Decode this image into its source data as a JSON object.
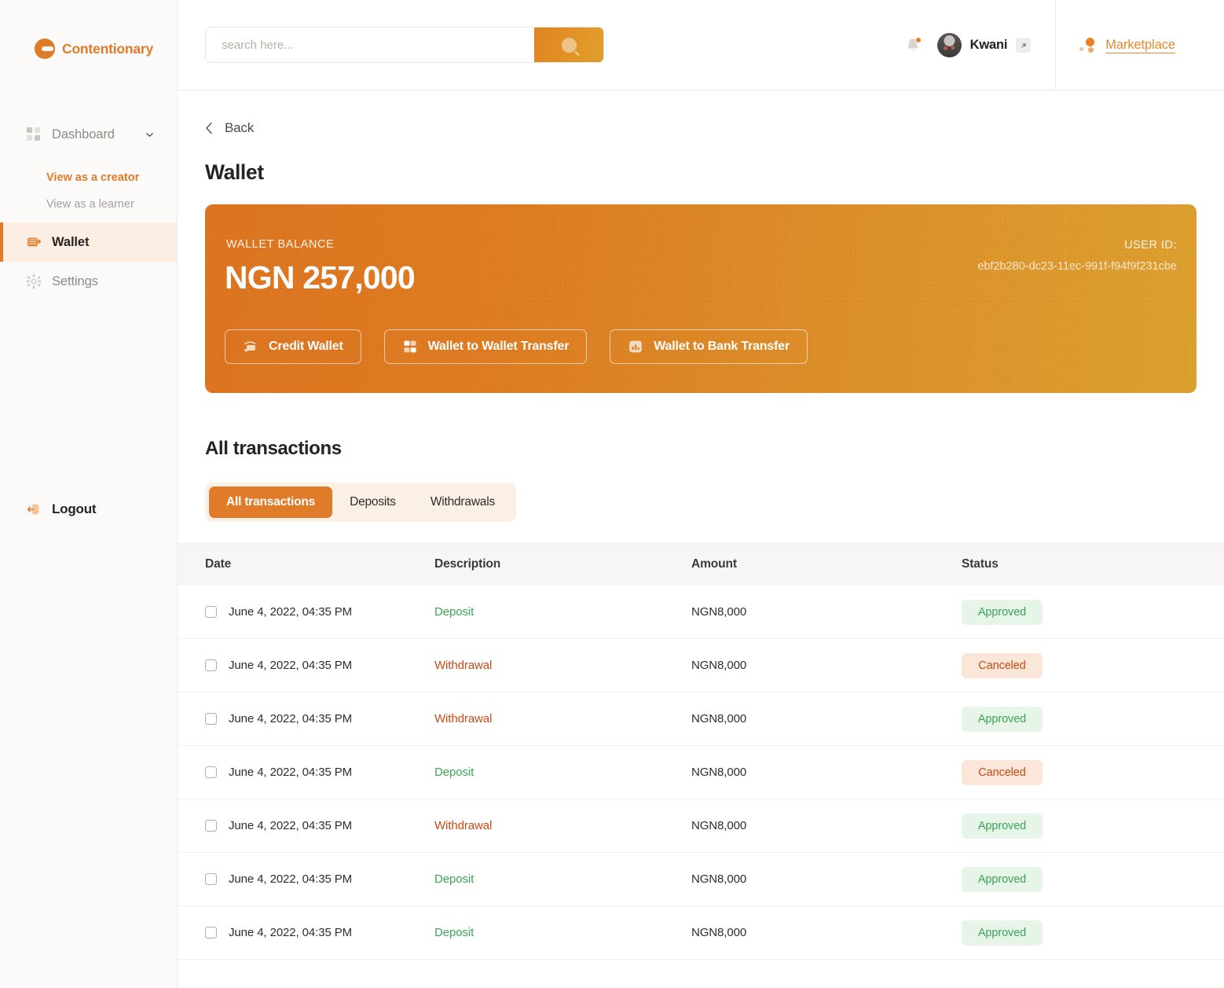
{
  "brand": {
    "name": "Contentionary",
    "logo_icon": "contentionary-c-logo",
    "accent": "#e07b2a"
  },
  "sidebar": {
    "dashboard": {
      "label": "Dashboard",
      "icon": "grid-squares-icon",
      "chevron": "chevron-down-icon"
    },
    "subnav": [
      {
        "label": "View as a creator",
        "state": "active"
      },
      {
        "label": "View as a learner",
        "state": "inactive"
      }
    ],
    "items": [
      {
        "label": "Wallet",
        "icon": "wallet-icon",
        "active": true
      },
      {
        "label": "Settings",
        "icon": "gear-icon",
        "active": false
      }
    ],
    "logout": {
      "label": "Logout",
      "icon": "logout-icon"
    }
  },
  "header": {
    "search": {
      "placeholder": "search here...",
      "value": "",
      "button_icon": "search-icon"
    },
    "notifications": {
      "icon": "bell-icon",
      "has_unread": true
    },
    "user": {
      "name": "Kwani",
      "avatar": "user-avatar",
      "external_icon": "external-link-icon"
    },
    "marketplace": {
      "label": "Marketplace",
      "icon": "marketplace-dots-icon"
    }
  },
  "page": {
    "back_label": "Back",
    "back_icon": "chevron-left-icon",
    "title": "Wallet"
  },
  "balance_card": {
    "label": "WALLET BALANCE",
    "amount": "NGN 257,000",
    "user_id_label": "USER ID:",
    "user_id_value": "ebf2b280-dc23-11ec-991f-f94f9f231cbe",
    "gradient_from": "#dd7420",
    "gradient_to": "#dca02e",
    "actions": [
      {
        "label": "Credit Wallet",
        "icon": "credit-wallet-icon"
      },
      {
        "label": "Wallet to Wallet Transfer",
        "icon": "wallet-transfer-icon"
      },
      {
        "label": "Wallet to Bank Transfer",
        "icon": "bank-transfer-icon"
      }
    ]
  },
  "transactions": {
    "heading": "All transactions",
    "tabs": [
      {
        "label": "All transactions",
        "active": true
      },
      {
        "label": "Deposits",
        "active": false
      },
      {
        "label": "Withdrawals",
        "active": false
      }
    ],
    "columns": [
      "Date",
      "Description",
      "Amount",
      "Status"
    ],
    "rows": [
      {
        "date": "June 4, 2022, 04:35 PM",
        "description": "Deposit",
        "amount": "NGN8,000",
        "status": "Approved"
      },
      {
        "date": "June 4, 2022, 04:35 PM",
        "description": "Withdrawal",
        "amount": "NGN8,000",
        "status": "Canceled"
      },
      {
        "date": "June 4, 2022, 04:35 PM",
        "description": "Withdrawal",
        "amount": "NGN8,000",
        "status": "Approved"
      },
      {
        "date": "June 4, 2022, 04:35 PM",
        "description": "Deposit",
        "amount": "NGN8,000",
        "status": "Canceled"
      },
      {
        "date": "June 4, 2022, 04:35 PM",
        "description": "Withdrawal",
        "amount": "NGN8,000",
        "status": "Approved"
      },
      {
        "date": "June 4, 2022, 04:35 PM",
        "description": "Deposit",
        "amount": "NGN8,000",
        "status": "Approved"
      },
      {
        "date": "June 4, 2022, 04:35 PM",
        "description": "Deposit",
        "amount": "NGN8,000",
        "status": "Approved"
      }
    ],
    "colors": {
      "deposit": "#3aa356",
      "withdrawal": "#c94a12",
      "approved_bg": "#e7f5e9",
      "canceled_bg": "#fbe7da"
    }
  }
}
